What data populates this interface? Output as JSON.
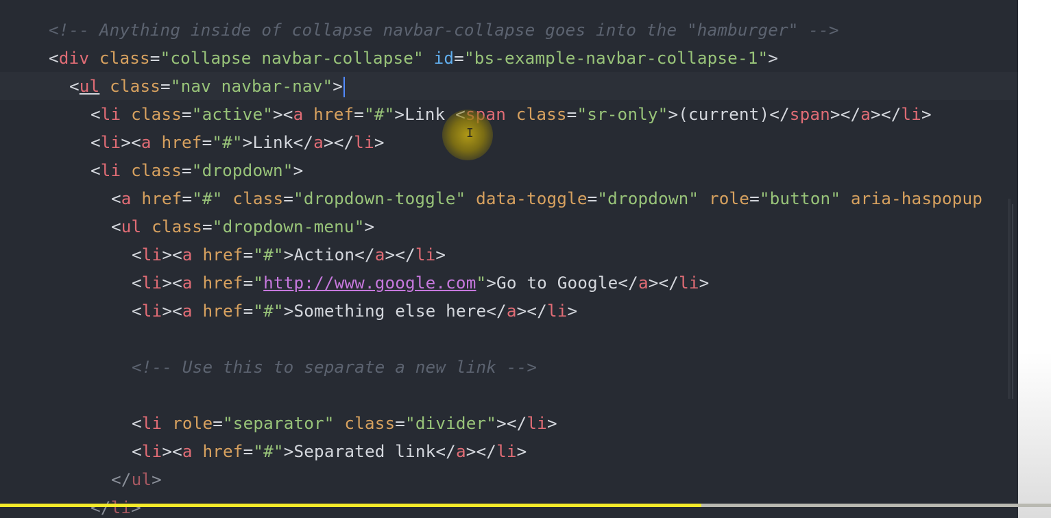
{
  "editor": {
    "lines": [
      {
        "tokens": [
          {
            "t": "<!-- Anything inside of collapse navbar-collapse goes into the \"hamburger\" -->",
            "c": "t-comment"
          }
        ]
      },
      {
        "tokens": [
          {
            "t": "<",
            "c": "t-punct"
          },
          {
            "t": "div",
            "c": "t-tag"
          },
          {
            "t": " ",
            "c": "t-plain"
          },
          {
            "t": "class",
            "c": "t-attr"
          },
          {
            "t": "=",
            "c": "t-punct"
          },
          {
            "t": "\"collapse navbar-collapse\"",
            "c": "t-str"
          },
          {
            "t": " ",
            "c": "t-plain"
          },
          {
            "t": "id",
            "c": "t-attr-id"
          },
          {
            "t": "=",
            "c": "t-punct"
          },
          {
            "t": "\"bs-example-navbar-collapse-1\"",
            "c": "t-str"
          },
          {
            "t": ">",
            "c": "t-punct"
          }
        ]
      },
      {
        "current": true,
        "tokens": [
          {
            "t": "<",
            "c": "t-punct"
          },
          {
            "t": "ul",
            "c": "t-tag ul-tag"
          },
          {
            "t": " ",
            "c": "t-plain"
          },
          {
            "t": "class",
            "c": "t-attr"
          },
          {
            "t": "=",
            "c": "t-punct"
          },
          {
            "t": "\"nav navbar-nav\"",
            "c": "t-str"
          },
          {
            "t": ">",
            "c": "t-punct"
          }
        ]
      },
      {
        "tokens": [
          {
            "t": "<",
            "c": "t-punct"
          },
          {
            "t": "li",
            "c": "t-tag"
          },
          {
            "t": " ",
            "c": "t-plain"
          },
          {
            "t": "class",
            "c": "t-attr"
          },
          {
            "t": "=",
            "c": "t-punct"
          },
          {
            "t": "\"active\"",
            "c": "t-str"
          },
          {
            "t": "><",
            "c": "t-punct"
          },
          {
            "t": "a",
            "c": "t-tag"
          },
          {
            "t": " ",
            "c": "t-plain"
          },
          {
            "t": "href",
            "c": "t-attr"
          },
          {
            "t": "=",
            "c": "t-punct"
          },
          {
            "t": "\"#\"",
            "c": "t-str"
          },
          {
            "t": ">Link <",
            "c": "t-punct"
          },
          {
            "t": "span",
            "c": "t-tag"
          },
          {
            "t": " ",
            "c": "t-plain"
          },
          {
            "t": "class",
            "c": "t-attr"
          },
          {
            "t": "=",
            "c": "t-punct"
          },
          {
            "t": "\"sr-only\"",
            "c": "t-str"
          },
          {
            "t": ">(current)</",
            "c": "t-punct"
          },
          {
            "t": "span",
            "c": "t-tag"
          },
          {
            "t": "></",
            "c": "t-punct"
          },
          {
            "t": "a",
            "c": "t-tag"
          },
          {
            "t": "></",
            "c": "t-punct"
          },
          {
            "t": "li",
            "c": "t-tag"
          },
          {
            "t": ">",
            "c": "t-punct"
          }
        ]
      },
      {
        "tokens": [
          {
            "t": "<",
            "c": "t-punct"
          },
          {
            "t": "li",
            "c": "t-tag"
          },
          {
            "t": "><",
            "c": "t-punct"
          },
          {
            "t": "a",
            "c": "t-tag"
          },
          {
            "t": " ",
            "c": "t-plain"
          },
          {
            "t": "href",
            "c": "t-attr"
          },
          {
            "t": "=",
            "c": "t-punct"
          },
          {
            "t": "\"#\"",
            "c": "t-str"
          },
          {
            "t": ">Link</",
            "c": "t-punct"
          },
          {
            "t": "a",
            "c": "t-tag"
          },
          {
            "t": "></",
            "c": "t-punct"
          },
          {
            "t": "li",
            "c": "t-tag"
          },
          {
            "t": ">",
            "c": "t-punct"
          }
        ]
      },
      {
        "tokens": [
          {
            "t": "<",
            "c": "t-punct"
          },
          {
            "t": "li",
            "c": "t-tag"
          },
          {
            "t": " ",
            "c": "t-plain"
          },
          {
            "t": "class",
            "c": "t-attr"
          },
          {
            "t": "=",
            "c": "t-punct"
          },
          {
            "t": "\"dropdown\"",
            "c": "t-str"
          },
          {
            "t": ">",
            "c": "t-punct"
          }
        ]
      },
      {
        "tokens": [
          {
            "t": "<",
            "c": "t-punct"
          },
          {
            "t": "a",
            "c": "t-tag"
          },
          {
            "t": " ",
            "c": "t-plain"
          },
          {
            "t": "href",
            "c": "t-attr"
          },
          {
            "t": "=",
            "c": "t-punct"
          },
          {
            "t": "\"#\"",
            "c": "t-str"
          },
          {
            "t": " ",
            "c": "t-plain"
          },
          {
            "t": "class",
            "c": "t-attr"
          },
          {
            "t": "=",
            "c": "t-punct"
          },
          {
            "t": "\"dropdown-toggle\"",
            "c": "t-str"
          },
          {
            "t": " ",
            "c": "t-plain"
          },
          {
            "t": "data-toggle",
            "c": "t-attr"
          },
          {
            "t": "=",
            "c": "t-punct"
          },
          {
            "t": "\"dropdown\"",
            "c": "t-str"
          },
          {
            "t": " ",
            "c": "t-plain"
          },
          {
            "t": "role",
            "c": "t-attr"
          },
          {
            "t": "=",
            "c": "t-punct"
          },
          {
            "t": "\"button\"",
            "c": "t-str"
          },
          {
            "t": " ",
            "c": "t-plain"
          },
          {
            "t": "aria-haspopup",
            "c": "t-attr"
          }
        ]
      },
      {
        "tokens": [
          {
            "t": "<",
            "c": "t-punct"
          },
          {
            "t": "ul",
            "c": "t-tag"
          },
          {
            "t": " ",
            "c": "t-plain"
          },
          {
            "t": "class",
            "c": "t-attr"
          },
          {
            "t": "=",
            "c": "t-punct"
          },
          {
            "t": "\"dropdown-menu\"",
            "c": "t-str"
          },
          {
            "t": ">",
            "c": "t-punct"
          }
        ]
      },
      {
        "tokens": [
          {
            "t": "<",
            "c": "t-punct"
          },
          {
            "t": "li",
            "c": "t-tag"
          },
          {
            "t": "><",
            "c": "t-punct"
          },
          {
            "t": "a",
            "c": "t-tag"
          },
          {
            "t": " ",
            "c": "t-plain"
          },
          {
            "t": "href",
            "c": "t-attr"
          },
          {
            "t": "=",
            "c": "t-punct"
          },
          {
            "t": "\"#\"",
            "c": "t-str"
          },
          {
            "t": ">Action</",
            "c": "t-punct"
          },
          {
            "t": "a",
            "c": "t-tag"
          },
          {
            "t": "></",
            "c": "t-punct"
          },
          {
            "t": "li",
            "c": "t-tag"
          },
          {
            "t": ">",
            "c": "t-punct"
          }
        ]
      },
      {
        "tokens": [
          {
            "t": "<",
            "c": "t-punct"
          },
          {
            "t": "li",
            "c": "t-tag"
          },
          {
            "t": "><",
            "c": "t-punct"
          },
          {
            "t": "a",
            "c": "t-tag"
          },
          {
            "t": " ",
            "c": "t-plain"
          },
          {
            "t": "href",
            "c": "t-attr"
          },
          {
            "t": "=",
            "c": "t-punct"
          },
          {
            "t": "\"",
            "c": "t-str"
          },
          {
            "t": "http://www.google.com",
            "c": "t-link"
          },
          {
            "t": "\"",
            "c": "t-str"
          },
          {
            "t": ">Go to Google</",
            "c": "t-punct"
          },
          {
            "t": "a",
            "c": "t-tag"
          },
          {
            "t": "></",
            "c": "t-punct"
          },
          {
            "t": "li",
            "c": "t-tag"
          },
          {
            "t": ">",
            "c": "t-punct"
          }
        ]
      },
      {
        "tokens": [
          {
            "t": "<",
            "c": "t-punct"
          },
          {
            "t": "li",
            "c": "t-tag"
          },
          {
            "t": "><",
            "c": "t-punct"
          },
          {
            "t": "a",
            "c": "t-tag"
          },
          {
            "t": " ",
            "c": "t-plain"
          },
          {
            "t": "href",
            "c": "t-attr"
          },
          {
            "t": "=",
            "c": "t-punct"
          },
          {
            "t": "\"#\"",
            "c": "t-str"
          },
          {
            "t": ">Something else here</",
            "c": "t-punct"
          },
          {
            "t": "a",
            "c": "t-tag"
          },
          {
            "t": "></",
            "c": "t-punct"
          },
          {
            "t": "li",
            "c": "t-tag"
          },
          {
            "t": ">",
            "c": "t-punct"
          }
        ]
      },
      {
        "tokens": []
      },
      {
        "tokens": [
          {
            "t": "<!-- Use this to separate a new link -->",
            "c": "t-comment"
          }
        ]
      },
      {
        "tokens": []
      },
      {
        "tokens": [
          {
            "t": "<",
            "c": "t-punct"
          },
          {
            "t": "li",
            "c": "t-tag"
          },
          {
            "t": " ",
            "c": "t-plain"
          },
          {
            "t": "role",
            "c": "t-attr"
          },
          {
            "t": "=",
            "c": "t-punct"
          },
          {
            "t": "\"separator\"",
            "c": "t-str"
          },
          {
            "t": " ",
            "c": "t-plain"
          },
          {
            "t": "class",
            "c": "t-attr"
          },
          {
            "t": "=",
            "c": "t-punct"
          },
          {
            "t": "\"divider\"",
            "c": "t-str"
          },
          {
            "t": "></",
            "c": "t-punct"
          },
          {
            "t": "li",
            "c": "t-tag"
          },
          {
            "t": ">",
            "c": "t-punct"
          }
        ]
      },
      {
        "tokens": [
          {
            "t": "<",
            "c": "t-punct"
          },
          {
            "t": "li",
            "c": "t-tag"
          },
          {
            "t": "><",
            "c": "t-punct"
          },
          {
            "t": "a",
            "c": "t-tag"
          },
          {
            "t": " ",
            "c": "t-plain"
          },
          {
            "t": "href",
            "c": "t-attr"
          },
          {
            "t": "=",
            "c": "t-punct"
          },
          {
            "t": "\"#\"",
            "c": "t-str"
          },
          {
            "t": ">Separated link</",
            "c": "t-punct"
          },
          {
            "t": "a",
            "c": "t-tag"
          },
          {
            "t": "></",
            "c": "t-punct"
          },
          {
            "t": "li",
            "c": "t-tag"
          },
          {
            "t": ">",
            "c": "t-punct"
          }
        ]
      },
      {
        "tokens": [
          {
            "t": "</",
            "c": "t-dim"
          },
          {
            "t": "ul",
            "c": "t-tag-dim"
          },
          {
            "t": ">",
            "c": "t-dim"
          }
        ]
      },
      {
        "tokens": [
          {
            "t": "</",
            "c": "t-dim"
          },
          {
            "t": "li",
            "c": "t-tag-dim"
          },
          {
            "t": ">",
            "c": "t-dim"
          }
        ]
      }
    ]
  },
  "video_progress": {
    "played_fraction": 0.667,
    "buffered_fraction": 1.0
  },
  "colors": {
    "background": "#272b33",
    "tag": "#e06c75",
    "attribute": "#d7a15f",
    "id_attribute": "#61afef",
    "string": "#98c379",
    "link": "#c678dd",
    "comment": "#5c6370",
    "progress_played": "#f4ea2a"
  },
  "icons": {
    "mouse_cursor": "i-beam-cursor-icon"
  },
  "cursor_glyph": "I"
}
